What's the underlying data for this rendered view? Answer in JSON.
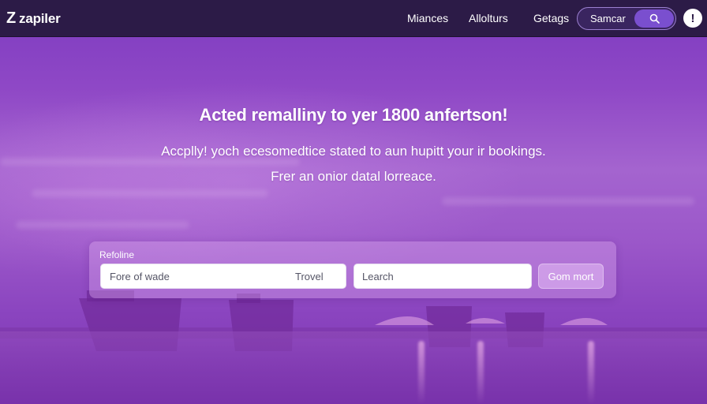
{
  "brand": {
    "logo_mark": "Z",
    "logo_text": "zapiler"
  },
  "nav": {
    "links": [
      "Miances",
      "Allolturs",
      "Getags"
    ],
    "search_label": "Samcar",
    "search_icon": "search-icon",
    "alert_icon": "exclamation-icon",
    "alert_glyph": "!"
  },
  "hero": {
    "title": "Acted remalliny to yer 1800 anfertson!",
    "subtitle_1": "Accplly! yoch ecesomedtice stated to aun hupitt your ir bookings.",
    "subtitle_2": "Frer an onior datal lorreace."
  },
  "search_panel": {
    "label": "Refoline",
    "field_1_value": "Fore of wade",
    "field_1_suffix": "Trovel",
    "field_2_value": "Learch",
    "button_label": "Gom mort"
  },
  "colors": {
    "navbar": "#2c1b47",
    "accent": "#7a4fcf",
    "hero_purple": "#8f48c6"
  }
}
